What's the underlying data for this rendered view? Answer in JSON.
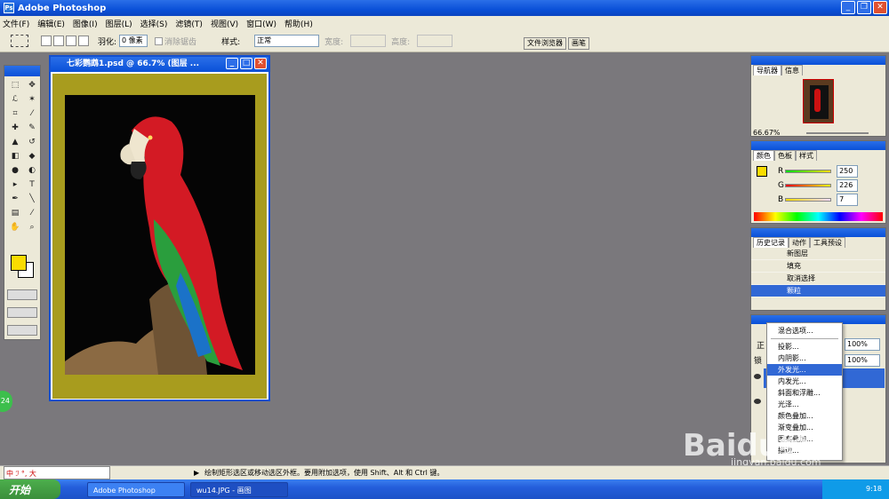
{
  "app": {
    "title": "Adobe Photoshop"
  },
  "menu": [
    "文件(F)",
    "编辑(E)",
    "图像(I)",
    "图层(L)",
    "选择(S)",
    "滤镜(T)",
    "视图(V)",
    "窗口(W)",
    "帮助(H)"
  ],
  "options": {
    "feather_label": "羽化:",
    "feather_value": "0 像素",
    "antialias_label": "消除锯齿",
    "style_label": "样式:",
    "style_value": "正常",
    "width_label": "宽度:",
    "height_label": "高度:",
    "tabs": [
      "文件浏览器",
      "画笔"
    ]
  },
  "document": {
    "title": "七彩鹦鹉1.psd @ 66.7% (图层 ..."
  },
  "navigator": {
    "tabs": [
      "导航器",
      "信息"
    ],
    "zoom": "66.67%"
  },
  "color_panel": {
    "tabs": [
      "颜色",
      "色板",
      "样式"
    ],
    "channels": [
      {
        "label": "R",
        "value": "250"
      },
      {
        "label": "G",
        "value": "226"
      },
      {
        "label": "B",
        "value": "7"
      }
    ],
    "foreground": "#fadc00"
  },
  "history": {
    "tabs": [
      "历史记录",
      "动作",
      "工具预设"
    ],
    "items": [
      "新图层",
      "填充",
      "取消选择",
      "颗粒"
    ]
  },
  "layers": {
    "opacity": "100%",
    "fill": "100%",
    "mode_label": "正",
    "lock_label": "锁"
  },
  "context_menu": {
    "items": [
      "混合选项...",
      "投影...",
      "内阴影...",
      "外发光...",
      "内发光...",
      "斜面和浮雕...",
      "光泽...",
      "颜色叠加...",
      "渐变叠加...",
      "图案叠加...",
      "描边..."
    ],
    "selected_index": 3
  },
  "status": {
    "text": "绘制矩形选区或移动选区外框。要用附加选项，使用 Shift、Alt 和 Ctrl 键。",
    "badge": "24"
  },
  "ime": {
    "text": "中 ℐ °, 大"
  },
  "taskbar": {
    "start": "开始",
    "tasks": [
      "Adobe Photoshop",
      "wu14.JPG - 画图"
    ],
    "clock": "9:18"
  },
  "watermark": {
    "text": "Baidu经验",
    "url": "jingyan.baidu.com"
  }
}
